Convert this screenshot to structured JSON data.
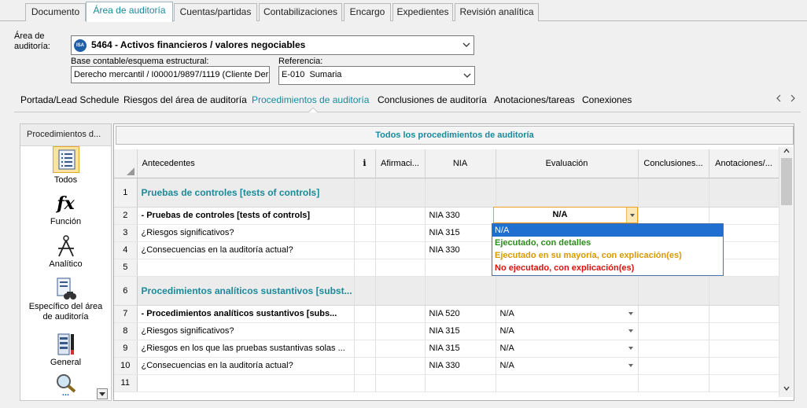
{
  "top_tabs": [
    {
      "label": "Documento",
      "active": false
    },
    {
      "label": "Área de auditoría",
      "active": true
    },
    {
      "label": "Cuentas/partidas",
      "active": false
    },
    {
      "label": "Contabilizaciones",
      "active": false
    },
    {
      "label": "Encargo",
      "active": false
    },
    {
      "label": "Expedientes",
      "active": false
    },
    {
      "label": "Revisión analítica",
      "active": false
    }
  ],
  "header": {
    "area_label_line1": "Área de",
    "area_label_line2": "auditoría:",
    "area_badge": "ISA",
    "area_value": "5464 - Activos financieros / valores negociables",
    "base_label": "Base contable/esquema estructural:",
    "base_value": "Derecho mercantil / I00001/9897/1119 (Cliente Der",
    "ref_label": "Referencia:",
    "ref_value": "E-010  Sumaria"
  },
  "sub_tabs": [
    {
      "label": "Portada/Lead Schedule",
      "active": false
    },
    {
      "label": "Riesgos del área de auditoría",
      "active": false
    },
    {
      "label": "Procedimientos de auditoría",
      "active": true
    },
    {
      "label": "Conclusiones de auditoría",
      "active": false
    },
    {
      "label": "Anotaciones/tareas",
      "active": false
    },
    {
      "label": "Conexiones",
      "active": false
    }
  ],
  "sidebar": {
    "title": "Procedimientos d...",
    "items": [
      {
        "label": "Todos",
        "icon": "document-list-icon",
        "selected": true
      },
      {
        "label": "Función",
        "icon": "function-fx-icon",
        "selected": false
      },
      {
        "label": "Analítico",
        "icon": "compass-icon",
        "selected": false
      },
      {
        "label": "Específico del área de auditoría",
        "icon": "binoculars-document-icon",
        "selected": false
      },
      {
        "label": "General",
        "icon": "ledger-icon",
        "selected": false
      },
      {
        "label": "...",
        "icon": "magnifier-icon",
        "selected": false
      }
    ]
  },
  "grid": {
    "banner": "Todos los procedimientos de auditoría",
    "columns": [
      "Antecedentes",
      "i",
      "Afirmaci...",
      "NIA",
      "Evaluación",
      "Conclusiones...",
      "Anotaciones/..."
    ],
    "rows": [
      {
        "n": "1",
        "type": "section",
        "text": "Pruebas de controles [tests of controls]",
        "nia": "",
        "eval": ""
      },
      {
        "n": "2",
        "type": "bold",
        "text": "- Pruebas de controles [tests of controls]",
        "nia": "NIA 330",
        "eval": "N/A"
      },
      {
        "n": "3",
        "type": "item",
        "text": "¿Riesgos significativos?",
        "nia": "NIA 315",
        "eval": ""
      },
      {
        "n": "4",
        "type": "item",
        "text": "¿Consecuencias en la auditoría actual?",
        "nia": "NIA 330",
        "eval": ""
      },
      {
        "n": "5",
        "type": "item",
        "text": "",
        "nia": "",
        "eval": ""
      },
      {
        "n": "6",
        "type": "section",
        "text": "Procedimientos analíticos sustantivos [subst...",
        "nia": "",
        "eval": ""
      },
      {
        "n": "7",
        "type": "bold",
        "text": "- Procedimientos analíticos sustantivos [subs...",
        "nia": "NIA 520",
        "eval": "N/A"
      },
      {
        "n": "8",
        "type": "item",
        "text": "¿Riesgos significativos?",
        "nia": "NIA 315",
        "eval": "N/A"
      },
      {
        "n": "9",
        "type": "item",
        "text": "¿Riesgos en los que las pruebas sustantivas solas ...",
        "nia": "NIA 315",
        "eval": "N/A"
      },
      {
        "n": "10",
        "type": "item",
        "text": "¿Consecuencias en la auditoría actual?",
        "nia": "NIA 330",
        "eval": "N/A"
      },
      {
        "n": "11",
        "type": "item",
        "text": "",
        "nia": "",
        "eval": ""
      }
    ]
  },
  "dropdown": {
    "current": "N/A",
    "options": [
      {
        "label": "N/A",
        "color": "#ffffff",
        "bg": "#1e6fd0"
      },
      {
        "label": "Ejecutado, con detalles",
        "color": "#2e8b1e",
        "bg": "#ffffff"
      },
      {
        "label": "Ejecutado en su mayoría, con explicación(es)",
        "color": "#d89a00",
        "bg": "#ffffff"
      },
      {
        "label": "No ejecutado, con explicación(es)",
        "color": "#e01010",
        "bg": "#ffffff"
      }
    ]
  },
  "colors": {
    "accent": "#1a8a9a",
    "selection": "#1e6fd0"
  }
}
